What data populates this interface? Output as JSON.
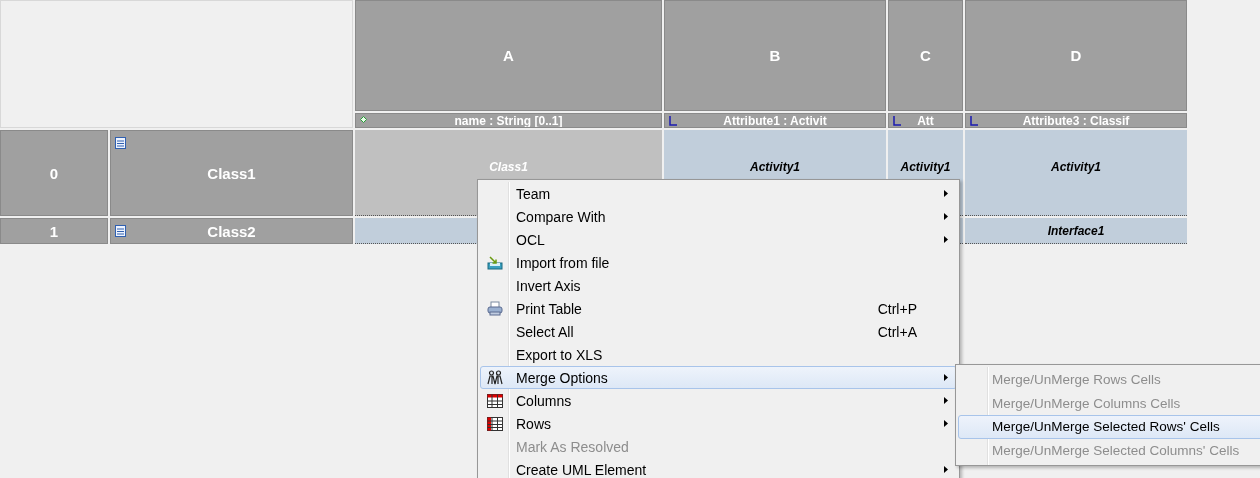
{
  "table": {
    "columns": [
      {
        "letter": "A",
        "attribute": "name : String [0..1]",
        "kind": "attribute"
      },
      {
        "letter": "B",
        "attribute": "Attribute1 : Activit",
        "kind": "reference"
      },
      {
        "letter": "C",
        "attribute": "Att",
        "kind": "reference"
      },
      {
        "letter": "D",
        "attribute": "Attribute3 : Classif",
        "kind": "reference"
      }
    ],
    "rows": [
      {
        "number": "0",
        "name": "Class1",
        "cells": [
          {
            "text": "Class1",
            "selected": true
          },
          {
            "text": "Activity1",
            "selected": false
          },
          {
            "text": "Activity1",
            "selected": false
          },
          {
            "text": "Activity1",
            "selected": false
          }
        ]
      },
      {
        "number": "1",
        "name": "Class2",
        "cells": [
          {
            "selected": false
          },
          {},
          {},
          {
            "text": "Interface1",
            "selected": false
          }
        ]
      }
    ]
  },
  "context_menu": {
    "items": [
      {
        "label": "Team",
        "submenu": true,
        "disabled": false,
        "selected": false
      },
      {
        "label": "Compare With",
        "submenu": true,
        "disabled": false,
        "selected": false
      },
      {
        "label": "OCL",
        "submenu": true,
        "disabled": false,
        "selected": false
      },
      {
        "label": "Import from file",
        "submenu": false,
        "disabled": false,
        "selected": false
      },
      {
        "label": "Invert Axis",
        "submenu": false,
        "disabled": false,
        "selected": false
      },
      {
        "label": "Print Table",
        "shortcut": "Ctrl+P",
        "submenu": false,
        "disabled": false,
        "selected": false
      },
      {
        "label": "Select All",
        "shortcut": "Ctrl+A",
        "submenu": false,
        "disabled": false,
        "selected": false
      },
      {
        "label": "Export to XLS",
        "submenu": false,
        "disabled": false,
        "selected": false
      },
      {
        "label": "Merge Options",
        "submenu": true,
        "disabled": false,
        "selected": true
      },
      {
        "label": "Columns",
        "submenu": true,
        "disabled": false,
        "selected": false
      },
      {
        "label": "Rows",
        "submenu": true,
        "disabled": false,
        "selected": false
      },
      {
        "label": "Mark As Resolved",
        "submenu": false,
        "disabled": true,
        "selected": false
      },
      {
        "label": "Create UML Element",
        "submenu": true,
        "disabled": false,
        "selected": false
      }
    ]
  },
  "submenu": {
    "items": [
      {
        "label": "Merge/UnMerge Rows Cells",
        "disabled": true,
        "selected": false
      },
      {
        "label": "Merge/UnMerge Columns Cells",
        "disabled": true,
        "selected": false
      },
      {
        "label": "Merge/UnMerge Selected Rows' Cells",
        "disabled": false,
        "selected": true
      },
      {
        "label": "Merge/UnMerge Selected Columns' Cells",
        "disabled": true,
        "selected": false
      }
    ]
  }
}
